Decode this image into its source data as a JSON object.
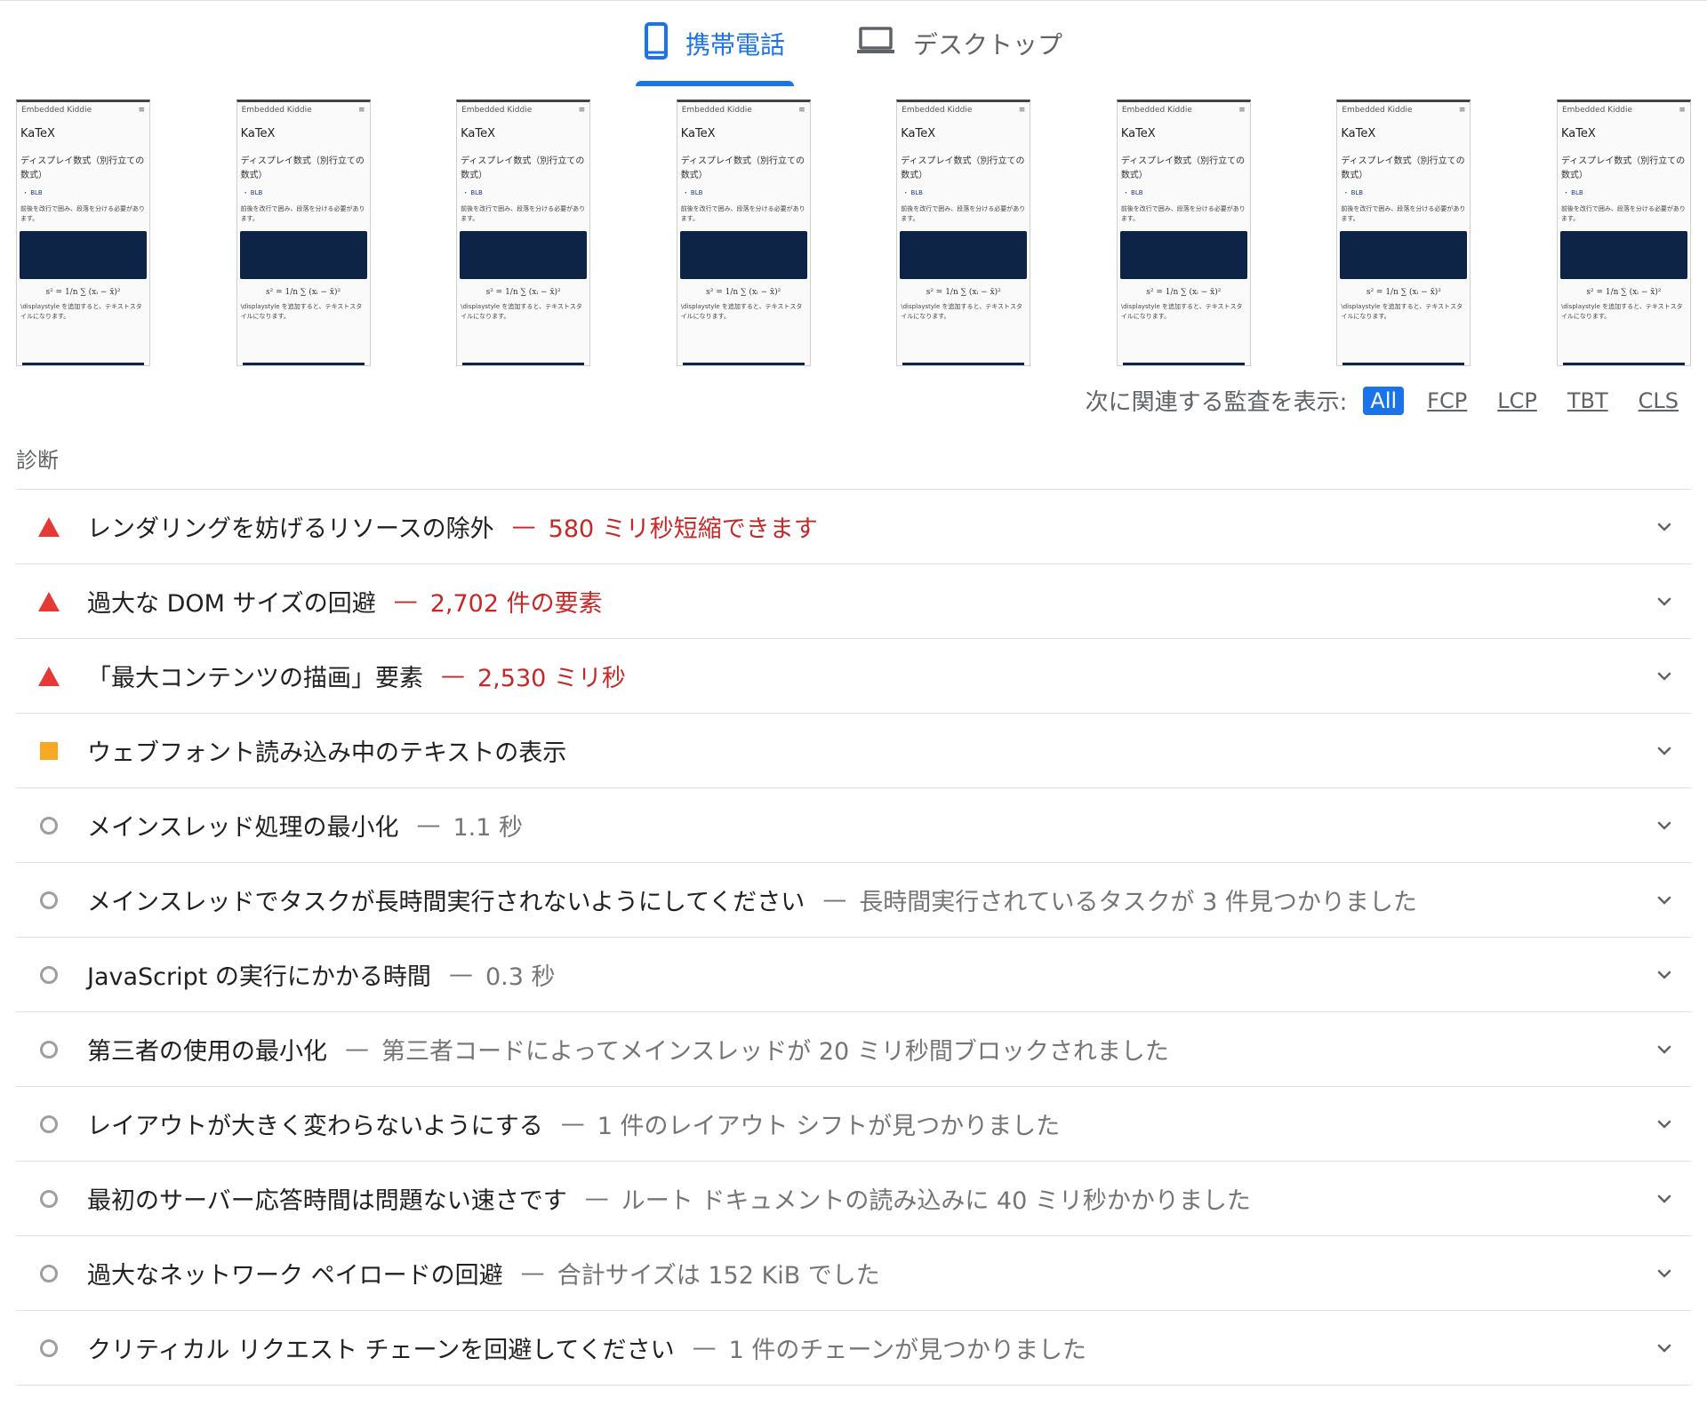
{
  "tabs": [
    {
      "label": "携帯電話",
      "icon": "phone-icon",
      "active": true
    },
    {
      "label": "デスクトップ",
      "icon": "laptop-icon",
      "active": false
    }
  ],
  "filmstrip": {
    "frames": [
      {
        "site": "Embedded Kiddie",
        "menu": "≡",
        "title": "KaTeX",
        "heading": "ディスプレイ数式（別行立ての数式）",
        "bullet": "・ BLB",
        "body": "前後を改行で囲み、段落を分ける必要があります。",
        "formula": "s² = 1/n ∑ (xᵢ − x̄)²",
        "foot": "\\displaystyle を追加すると、テキストスタイルになります。"
      },
      {
        "site": "Embedded Kiddie",
        "menu": "≡",
        "title": "KaTeX",
        "heading": "ディスプレイ数式（別行立ての数式）",
        "bullet": "・ BLB",
        "body": "前後を改行で囲み、段落を分ける必要があります。",
        "formula": "s² = 1/n ∑ (xᵢ − x̄)²",
        "foot": "\\displaystyle を追加すると、テキストスタイルになります。"
      },
      {
        "site": "Embedded Kiddie",
        "menu": "≡",
        "title": "KaTeX",
        "heading": "ディスプレイ数式（別行立ての数式）",
        "bullet": "・ BLB",
        "body": "前後を改行で囲み、段落を分ける必要があります。",
        "formula": "s² = 1/n ∑ (xᵢ − x̄)²",
        "foot": "\\displaystyle を追加すると、テキストスタイルになります。"
      },
      {
        "site": "Embedded Kiddie",
        "menu": "≡",
        "title": "KaTeX",
        "heading": "ディスプレイ数式（別行立ての数式）",
        "bullet": "・ BLB",
        "body": "前後を改行で囲み、段落を分ける必要があります。",
        "formula": "s² = 1/n ∑ (xᵢ − x̄)²",
        "foot": "\\displaystyle を追加すると、テキストスタイルになります。"
      },
      {
        "site": "Embedded Kiddie",
        "menu": "≡",
        "title": "KaTeX",
        "heading": "ディスプレイ数式（別行立ての数式）",
        "bullet": "・ BLB",
        "body": "前後を改行で囲み、段落を分ける必要があります。",
        "formula": "s² = 1/n ∑ (xᵢ − x̄)²",
        "foot": "\\displaystyle を追加すると、テキストスタイルになります。"
      },
      {
        "site": "Embedded Kiddie",
        "menu": "≡",
        "title": "KaTeX",
        "heading": "ディスプレイ数式（別行立ての数式）",
        "bullet": "・ BLB",
        "body": "前後を改行で囲み、段落を分ける必要があります。",
        "formula": "s² = 1/n ∑ (xᵢ − x̄)²",
        "foot": "\\displaystyle を追加すると、テキストスタイルになります。"
      },
      {
        "site": "Embedded Kiddie",
        "menu": "≡",
        "title": "KaTeX",
        "heading": "ディスプレイ数式（別行立ての数式）",
        "bullet": "・ BLB",
        "body": "前後を改行で囲み、段落を分ける必要があります。",
        "formula": "s² = 1/n ∑ (xᵢ − x̄)²",
        "foot": "\\displaystyle を追加すると、テキストスタイルになります。"
      },
      {
        "site": "Embedded Kiddie",
        "menu": "≡",
        "title": "KaTeX",
        "heading": "ディスプレイ数式（別行立ての数式）",
        "bullet": "・ BLB",
        "body": "前後を改行で囲み、段落を分ける必要があります。",
        "formula": "s² = 1/n ∑ (xᵢ − x̄)²",
        "foot": "\\displaystyle を追加すると、テキストスタイルになります。"
      }
    ]
  },
  "filter": {
    "label": "次に関連する監査を表示:",
    "chips": [
      {
        "label": "All",
        "active": true
      },
      {
        "label": "FCP",
        "active": false
      },
      {
        "label": "LCP",
        "active": false
      },
      {
        "label": "TBT",
        "active": false
      },
      {
        "label": "CLS",
        "active": false
      }
    ]
  },
  "diagnostics": {
    "section_title": "診断",
    "colors": {
      "fail": "#e53935",
      "average": "#f9a825",
      "info": "#9e9e9e"
    },
    "audits": [
      {
        "status": "fail",
        "title": "レンダリングを妨げるリソースの除外",
        "sep": "—",
        "detail": "580 ミリ秒短縮できます"
      },
      {
        "status": "fail",
        "title": "過大な DOM サイズの回避",
        "sep": "—",
        "detail": "2,702 件の要素"
      },
      {
        "status": "fail",
        "title": "「最大コンテンツの描画」要素",
        "sep": "—",
        "detail": "2,530 ミリ秒"
      },
      {
        "status": "average",
        "title": "ウェブフォント読み込み中のテキストの表示",
        "sep": "",
        "detail": ""
      },
      {
        "status": "info",
        "title": "メインスレッド処理の最小化",
        "sep": "—",
        "detail": "1.1 秒"
      },
      {
        "status": "info",
        "title": "メインスレッドでタスクが長時間実行されないようにしてください",
        "sep": "—",
        "detail": "長時間実行されているタスクが 3 件見つかりました"
      },
      {
        "status": "info",
        "title": "JavaScript の実行にかかる時間",
        "sep": "—",
        "detail": "0.3 秒"
      },
      {
        "status": "info",
        "title": "第三者の使用の最小化",
        "sep": "—",
        "detail": "第三者コードによってメインスレッドが 20 ミリ秒間ブロックされました"
      },
      {
        "status": "info",
        "title": "レイアウトが大きく変わらないようにする",
        "sep": "—",
        "detail": "1 件のレイアウト シフトが見つかりました"
      },
      {
        "status": "info",
        "title": "最初のサーバー応答時間は問題ない速さです",
        "sep": "—",
        "detail": "ルート ドキュメントの読み込みに 40 ミリ秒かかりました"
      },
      {
        "status": "info",
        "title": "過大なネットワーク ペイロードの回避",
        "sep": "—",
        "detail": "合計サイズは 152 KiB でした"
      },
      {
        "status": "info",
        "title": "クリティカル リクエスト チェーンを回避してください",
        "sep": "—",
        "detail": "1 件のチェーンが見つかりました"
      }
    ]
  }
}
